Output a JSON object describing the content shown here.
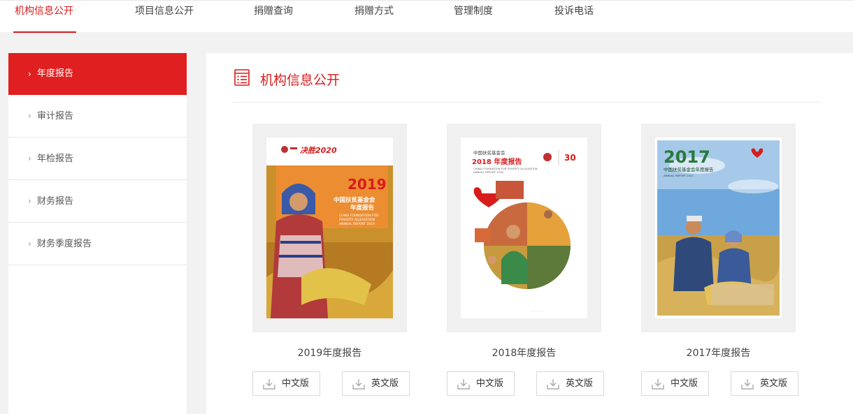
{
  "topnav": {
    "tabs": [
      "机构信息公开",
      "项目信息公开",
      "捐赠查询",
      "捐赠方式",
      "管理制度",
      "投诉电话"
    ]
  },
  "sidebar": {
    "items": [
      "年度报告",
      "审计报告",
      "年检报告",
      "财务报告",
      "财务季度报告"
    ]
  },
  "main": {
    "title": "机构信息公开",
    "reports": [
      {
        "name": "2019年度报告",
        "cover": {
          "year": "2019",
          "badge": "决胜2020",
          "cn_title_1": "中国扶贫基金会",
          "cn_title_2": "年度报告",
          "en_1": "CHINA FOUNDATION FOR",
          "en_2": "POVERTY ALLEVIATION",
          "en_3": "ANNUAL REPORT 2019"
        },
        "cn_label": "中文版",
        "en_label": "英文版"
      },
      {
        "name": "2018年度报告",
        "cover": {
          "org": "中国扶贫基金会",
          "title": "2018 年度报告",
          "en": "CHINA FOUNDATION FOR POVERTY ALLEVIATION",
          "en_2": "ANNUAL REPORT 2018",
          "anniv": "30"
        },
        "cn_label": "中文版",
        "en_label": "英文版"
      },
      {
        "name": "2017年度报告",
        "cover": {
          "year": "2017",
          "title": "中国扶贫基金会年度报告",
          "en": "ANNUAL REPORT 2017"
        },
        "cn_label": "中文版",
        "en_label": "英文版"
      }
    ]
  },
  "colors": {
    "accent": "#d71c1c",
    "sidebar_active": "#e02020"
  }
}
